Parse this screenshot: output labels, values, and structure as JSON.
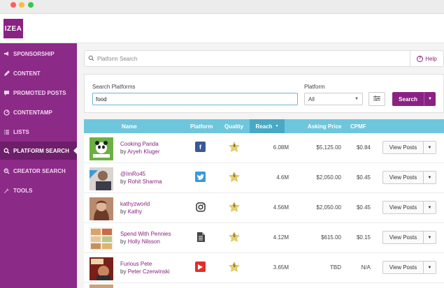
{
  "app": {
    "logo_text": "IZEA",
    "brand_color": "#8a2283"
  },
  "sidebar": {
    "items": [
      {
        "label": "SPONSORSHIP",
        "icon": "megaphone-icon",
        "active": false
      },
      {
        "label": "CONTENT",
        "icon": "pencil-icon",
        "active": false
      },
      {
        "label": "PROMOTED POSTS",
        "icon": "chat-icon",
        "active": false
      },
      {
        "label": "CONTENTAMP",
        "icon": "speedometer-icon",
        "active": false
      },
      {
        "label": "LISTS",
        "icon": "list-icon",
        "active": false
      },
      {
        "label": "PLATFORM SEARCH",
        "icon": "search-icon",
        "active": true
      },
      {
        "label": "CREATOR SEARCH",
        "icon": "person-search-icon",
        "active": false
      },
      {
        "label": "TOOLS",
        "icon": "wrench-icon",
        "active": false
      }
    ]
  },
  "search": {
    "placeholder": "Platform Search",
    "help_label": "Help"
  },
  "filters": {
    "search_platforms_label": "Search Platforms",
    "query_value": "food",
    "platform_label": "Platform",
    "platform_selected": "All",
    "search_button": "Search"
  },
  "table": {
    "headers": {
      "name": "Name",
      "platform": "Platform",
      "quality": "Quality",
      "reach": "Reach",
      "asking_price": "Asking Price",
      "cpmf": "CPMF"
    },
    "rows": [
      {
        "name": "Cooking Panda",
        "by": "by",
        "author": "Aryeh Kluger",
        "platform": "facebook",
        "quality": "4",
        "reach": "6.08M",
        "price": "$5,125.00",
        "cpmf": "$0.84",
        "action": "View Posts"
      },
      {
        "name": "@ImRo45",
        "by": "by",
        "author": "Rohit Sharma",
        "platform": "twitter",
        "quality": "5",
        "reach": "4.6M",
        "price": "$2,050.00",
        "cpmf": "$0.45",
        "action": "View Posts"
      },
      {
        "name": "kathyzworld",
        "by": "by",
        "author": "Kathy",
        "platform": "instagram",
        "quality": "5",
        "reach": "4.56M",
        "price": "$2,050.00",
        "cpmf": "$0.45",
        "action": "View Posts"
      },
      {
        "name": "Spend With Pennies",
        "by": "by",
        "author": "Holly Nilsson",
        "platform": "blog",
        "quality": "5",
        "reach": "4.12M",
        "price": "$615.00",
        "cpmf": "$0.15",
        "action": "View Posts"
      },
      {
        "name": "Furious Pete",
        "by": "by",
        "author": "Peter Czerwinski",
        "platform": "youtube",
        "quality": "5",
        "reach": "3.65M",
        "price": "TBD",
        "cpmf": "N/A",
        "action": "View Posts"
      }
    ]
  }
}
